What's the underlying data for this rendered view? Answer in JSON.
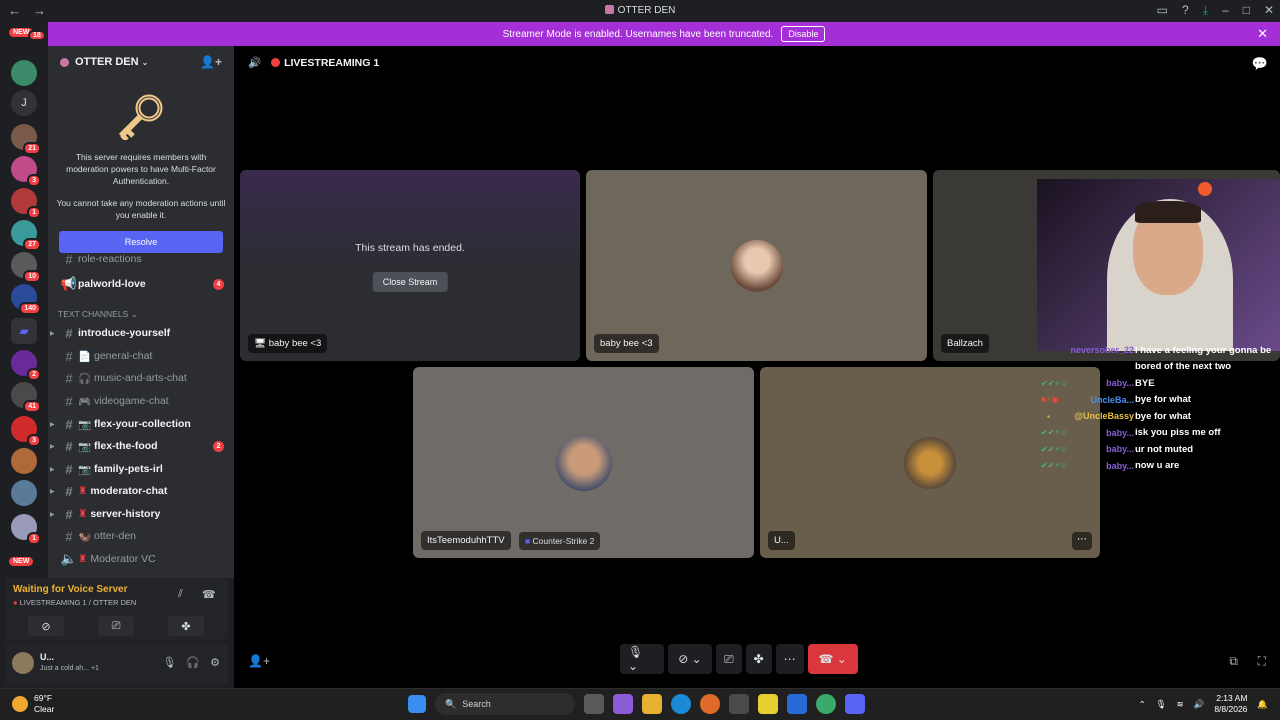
{
  "window": {
    "title": "OTTER DEN"
  },
  "banner": {
    "text": "Streamer Mode is enabled. Usernames have been truncated.",
    "disable_label": "Disable"
  },
  "guilds": {
    "new_top": "NEW",
    "new_bottom": "NEW",
    "letter": "J",
    "badges": [
      "18",
      "21",
      "3",
      "1",
      "27",
      "10",
      "140",
      "2",
      "41",
      "3",
      "1"
    ]
  },
  "server": {
    "name": "OTTER DEN",
    "mfa_line1": "This server requires members with moderation powers to have Multi-Factor Authentication.",
    "mfa_line2": "You cannot take any moderation actions until you enable it.",
    "resolve_label": "Resolve"
  },
  "channels": {
    "partial": "role-reactions",
    "palworld": {
      "name": "palworld-love",
      "badge": "4"
    },
    "category": "TEXT CHANNELS",
    "items": [
      {
        "name": "introduce-yourself",
        "prefix": ""
      },
      {
        "name": "general-chat",
        "prefix": "📄"
      },
      {
        "name": "music-and-arts-chat",
        "prefix": "🎧"
      },
      {
        "name": "videogame-chat",
        "prefix": "🎮"
      },
      {
        "name": "flex-your-collection",
        "prefix": "📷"
      },
      {
        "name": "flex-the-food",
        "prefix": "📷",
        "badge": "2"
      },
      {
        "name": "family-pets-irl",
        "prefix": "📷"
      },
      {
        "name": "moderator-chat",
        "prefix": "♜"
      },
      {
        "name": "server-history",
        "prefix": "♜"
      },
      {
        "name": "otter-den",
        "prefix": "🦦"
      },
      {
        "name": "Moderator VC",
        "prefix": "♜"
      }
    ]
  },
  "voice": {
    "status": "Waiting for Voice Server",
    "sub": "LIVESTREAMING 1 / OTTER DEN"
  },
  "user": {
    "name": "U...",
    "status": "Just a cold ah... +1"
  },
  "stage": {
    "channel": "LIVESTREAMING 1",
    "ended_text": "This stream has ended.",
    "close_label": "Close Stream",
    "tiles": [
      {
        "label": "baby bee <3"
      },
      {
        "label": "baby bee <3"
      },
      {
        "label": "Ballzach"
      },
      {
        "label": "ItsTeemoduhhTTV",
        "game": "Counter-Strike 2"
      },
      {
        "label": "U..."
      }
    ]
  },
  "overlay_chat": [
    {
      "user": "neversober_22",
      "msg": "I have a feeling your gonna be",
      "color": "#8a5cd6"
    },
    {
      "user": "",
      "msg": "bored of the next two",
      "color": "#ffffff"
    },
    {
      "user": "baby...",
      "msg": "BYE",
      "color": "#8a5cd6"
    },
    {
      "user": "UncleBa...",
      "msg": "bye for what",
      "color": "#4a8ff0"
    },
    {
      "user": "@UncleBassy",
      "msg": "bye for what",
      "color": "#e6c04a"
    },
    {
      "user": "baby...",
      "msg": "isk you piss me off",
      "color": "#8a5cd6"
    },
    {
      "user": "baby...",
      "msg": "ur not muted",
      "color": "#8a5cd6"
    },
    {
      "user": "baby...",
      "msg": "now u are",
      "color": "#8a5cd6"
    }
  ],
  "taskbar": {
    "weather_temp": "69°F",
    "weather_desc": "Clear",
    "search_placeholder": "Search",
    "time": "2:13 AM",
    "date": "8/8/2026"
  },
  "colors": {
    "brand": "#5865f2",
    "banner": "#a42fd6",
    "danger": "#da373c"
  }
}
